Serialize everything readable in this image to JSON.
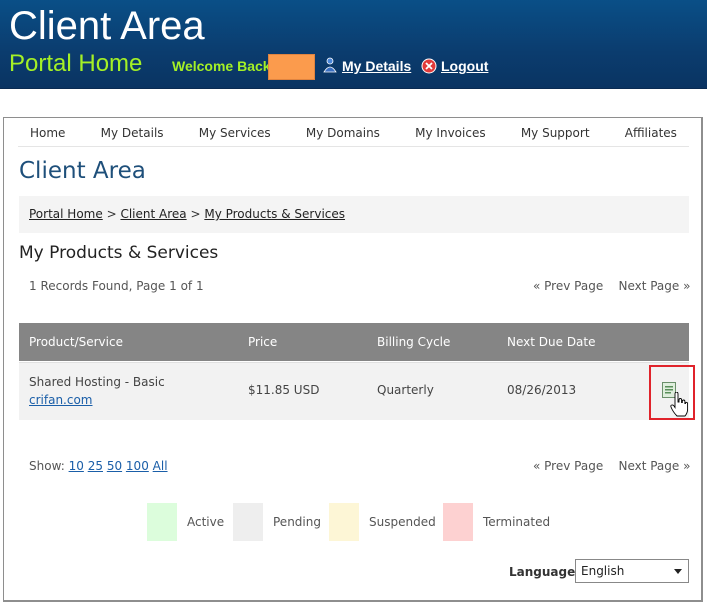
{
  "header": {
    "site_title": "Client Area",
    "portal_home": "Portal Home",
    "welcome": "Welcome Back",
    "my_details": "My Details",
    "logout": "Logout"
  },
  "nav": {
    "items": [
      "Home",
      "My Details",
      "My Services",
      "My Domains",
      "My Invoices",
      "My Support",
      "Affiliates"
    ]
  },
  "page": {
    "title": "Client Area",
    "breadcrumb": [
      "Portal Home",
      "Client Area",
      "My Products & Services"
    ],
    "breadcrumb_sep": ">",
    "section_title": "My Products & Services",
    "records_text": "1 Records Found, Page 1 of 1",
    "prev_page": "« Prev Page",
    "next_page": "Next Page »"
  },
  "table": {
    "headers": [
      "Product/Service",
      "Price",
      "Billing Cycle",
      "Next Due Date"
    ],
    "rows": [
      {
        "product": "Shared Hosting - Basic",
        "domain": "crifan.com",
        "price": "$11.85 USD",
        "billing_cycle": "Quarterly",
        "next_due": "08/26/2013"
      }
    ]
  },
  "show": {
    "label": "Show:",
    "options": [
      "10",
      "25",
      "50",
      "100",
      "All"
    ]
  },
  "legend": [
    {
      "label": "Active",
      "color": "#dcfddc"
    },
    {
      "label": "Pending",
      "color": "#eeeeee"
    },
    {
      "label": "Suspended",
      "color": "#fdf6d6"
    },
    {
      "label": "Terminated",
      "color": "#fdd1d1"
    }
  ],
  "language": {
    "label": "Language:",
    "selected": "English"
  },
  "colors": {
    "header_bg": "#0b3c6e",
    "accent_green": "#a4f026",
    "title_blue": "#1e4f7a",
    "link_blue": "#1a5ea8",
    "highlight_red": "#e0232b"
  }
}
